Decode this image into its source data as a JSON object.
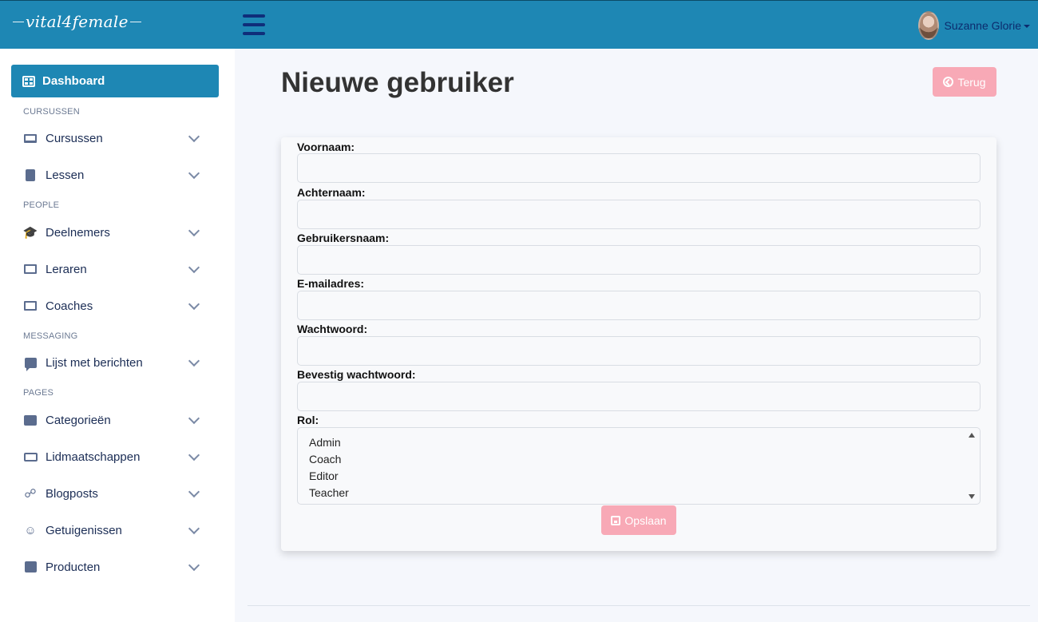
{
  "brand": {
    "logo_text": "vital4female"
  },
  "header": {
    "user_name": "Suzanne Glorie"
  },
  "sidebar": {
    "dashboard_label": "Dashboard",
    "sections": {
      "cursussen": "CURSUSSEN",
      "people": "PEOPLE",
      "messaging": "MESSAGING",
      "pages": "PAGES"
    },
    "items": [
      {
        "label": "Cursussen",
        "icon": "laptop-icon"
      },
      {
        "label": "Lessen",
        "icon": "book-icon"
      },
      {
        "label": "Deelnemers",
        "icon": "graduation-cap-icon"
      },
      {
        "label": "Leraren",
        "icon": "teacher-icon"
      },
      {
        "label": "Coaches",
        "icon": "chalkboard-user-icon"
      },
      {
        "label": "Lijst met berichten",
        "icon": "message-icon"
      },
      {
        "label": "Categorieën",
        "icon": "list-icon"
      },
      {
        "label": "Lidmaatschappen",
        "icon": "ticket-icon"
      },
      {
        "label": "Blogposts",
        "icon": "blog-icon"
      },
      {
        "label": "Getuigenissen",
        "icon": "smile-icon"
      },
      {
        "label": "Producten",
        "icon": "gift-icon"
      }
    ]
  },
  "main": {
    "title": "Nieuwe gebruiker",
    "back_button": "Terug",
    "save_button": "Opslaan",
    "form": {
      "fields": [
        {
          "label": "Voornaam:",
          "value": ""
        },
        {
          "label": "Achternaam:",
          "value": ""
        },
        {
          "label": "Gebruikersnaam:",
          "value": ""
        },
        {
          "label": "E-mailadres:",
          "value": ""
        },
        {
          "label": "Wachtwoord:",
          "value": ""
        },
        {
          "label": "Bevestig wachtwoord:",
          "value": ""
        }
      ],
      "role_label": "Rol:",
      "role_options": [
        "Admin",
        "Coach",
        "Editor",
        "Teacher"
      ]
    }
  },
  "colors": {
    "primary": "#1e87b4",
    "accent_button": "#f8a9b6",
    "navy": "#0f2e7a"
  }
}
